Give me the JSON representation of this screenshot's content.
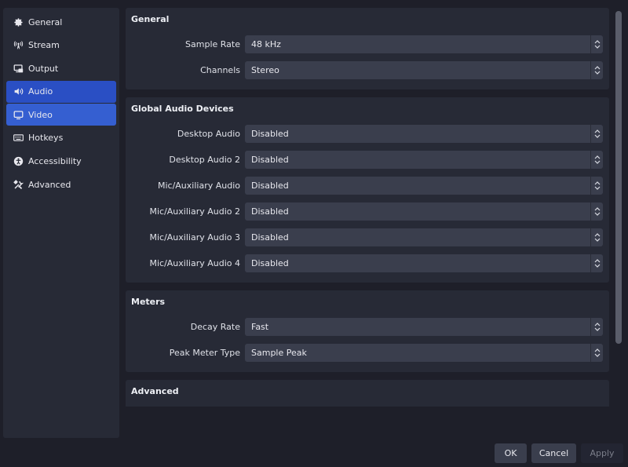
{
  "sidebar": {
    "items": [
      {
        "label": "General",
        "icon": "gear-icon"
      },
      {
        "label": "Stream",
        "icon": "antenna-icon"
      },
      {
        "label": "Output",
        "icon": "output-icon"
      },
      {
        "label": "Audio",
        "icon": "speaker-icon",
        "state": "selected"
      },
      {
        "label": "Video",
        "icon": "monitor-icon",
        "state": "hover"
      },
      {
        "label": "Hotkeys",
        "icon": "keyboard-icon"
      },
      {
        "label": "Accessibility",
        "icon": "accessibility-icon"
      },
      {
        "label": "Advanced",
        "icon": "tools-icon"
      }
    ]
  },
  "groups": {
    "general": {
      "title": "General",
      "rows": [
        {
          "label": "Sample Rate",
          "value": "48 kHz"
        },
        {
          "label": "Channels",
          "value": "Stereo"
        }
      ]
    },
    "devices": {
      "title": "Global Audio Devices",
      "rows": [
        {
          "label": "Desktop Audio",
          "value": "Disabled"
        },
        {
          "label": "Desktop Audio 2",
          "value": "Disabled"
        },
        {
          "label": "Mic/Auxiliary Audio",
          "value": "Disabled"
        },
        {
          "label": "Mic/Auxiliary Audio 2",
          "value": "Disabled"
        },
        {
          "label": "Mic/Auxiliary Audio 3",
          "value": "Disabled"
        },
        {
          "label": "Mic/Auxiliary Audio 4",
          "value": "Disabled"
        }
      ]
    },
    "meters": {
      "title": "Meters",
      "rows": [
        {
          "label": "Decay Rate",
          "value": "Fast"
        },
        {
          "label": "Peak Meter Type",
          "value": "Sample Peak"
        }
      ]
    },
    "advanced": {
      "title": "Advanced"
    }
  },
  "buttons": {
    "ok": "OK",
    "cancel": "Cancel",
    "apply": "Apply"
  },
  "colors": {
    "selected": "#2a4fc4",
    "hover": "#355fd1",
    "panel": "#272a36",
    "background": "#1e1f29"
  }
}
